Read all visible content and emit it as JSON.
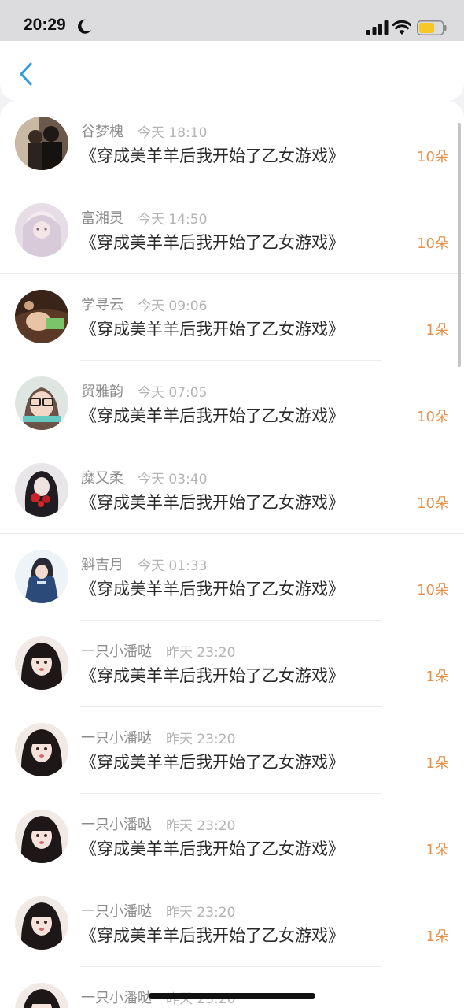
{
  "status_bar": {
    "time": "20:29"
  },
  "colors": {
    "accent": "#2f9be0",
    "gift": "#e5914a",
    "name": "#8c8c8c",
    "time": "#b3b3b3"
  },
  "items": [
    {
      "name": "谷梦槐",
      "time": "今天 18:10",
      "title": "《穿成美羊羊后我开始了乙女游戏》",
      "count": "10朵"
    },
    {
      "name": "富湘灵",
      "time": "今天 14:50",
      "title": "《穿成美羊羊后我开始了乙女游戏》",
      "count": "10朵"
    },
    {
      "name": "学寻云",
      "time": "今天 09:06",
      "title": "《穿成美羊羊后我开始了乙女游戏》",
      "count": "1朵"
    },
    {
      "name": "贸雅韵",
      "time": "今天 07:05",
      "title": "《穿成美羊羊后我开始了乙女游戏》",
      "count": "10朵"
    },
    {
      "name": "糜又柔",
      "time": "今天 03:40",
      "title": "《穿成美羊羊后我开始了乙女游戏》",
      "count": "10朵"
    },
    {
      "name": "斛吉月",
      "time": "今天 01:33",
      "title": "《穿成美羊羊后我开始了乙女游戏》",
      "count": "10朵"
    },
    {
      "name": "一只小潘哒",
      "time": "昨天 23:20",
      "title": "《穿成美羊羊后我开始了乙女游戏》",
      "count": "1朵"
    },
    {
      "name": "一只小潘哒",
      "time": "昨天 23:20",
      "title": "《穿成美羊羊后我开始了乙女游戏》",
      "count": "1朵"
    },
    {
      "name": "一只小潘哒",
      "time": "昨天 23:20",
      "title": "《穿成美羊羊后我开始了乙女游戏》",
      "count": "1朵"
    },
    {
      "name": "一只小潘哒",
      "time": "昨天 23:20",
      "title": "《穿成美羊羊后我开始了乙女游戏》",
      "count": "1朵"
    },
    {
      "name": "一只小潘哒",
      "time": "昨天 23:20",
      "title": "",
      "count": ""
    }
  ]
}
